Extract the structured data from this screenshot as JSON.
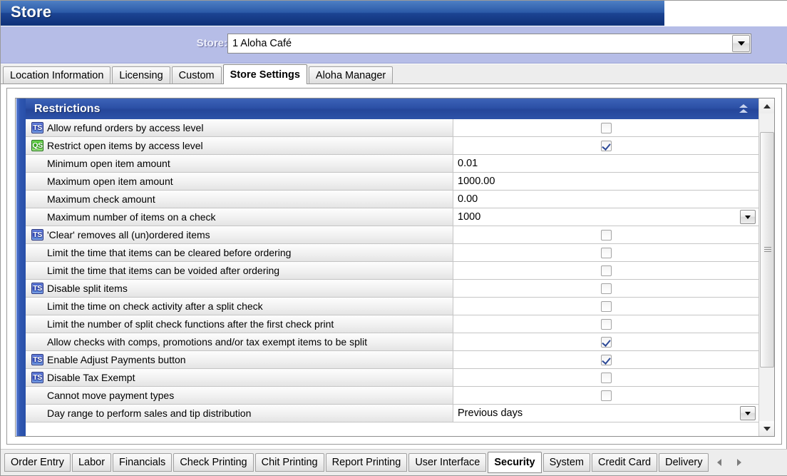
{
  "window": {
    "title": "Store"
  },
  "store_selector": {
    "label": "Store:",
    "value": "1 Aloha Café",
    "dropdown_icon": "chevron-down-icon"
  },
  "top_tabs": [
    {
      "label": "Location Information",
      "active": false
    },
    {
      "label": "Licensing",
      "active": false
    },
    {
      "label": "Custom",
      "active": false
    },
    {
      "label": "Store Settings",
      "active": true
    },
    {
      "label": "Aloha Manager",
      "active": false
    }
  ],
  "section": {
    "title": "Restrictions",
    "collapse_icon": "double-chevron-up-icon"
  },
  "rows": [
    {
      "badge": "TS",
      "label": "Allow refund orders by access level",
      "type": "checkbox",
      "value": "unchecked"
    },
    {
      "badge": "QS",
      "label": "Restrict open items by access level",
      "type": "checkbox",
      "value": "checked"
    },
    {
      "badge": "",
      "label": "Minimum open item amount",
      "type": "text",
      "value": "0.01"
    },
    {
      "badge": "",
      "label": "Maximum open item amount",
      "type": "text",
      "value": "1000.00"
    },
    {
      "badge": "",
      "label": "Maximum check amount",
      "type": "text",
      "value": "0.00"
    },
    {
      "badge": "",
      "label": "Maximum number of items on a check",
      "type": "dropdown",
      "value": "1000"
    },
    {
      "badge": "TS",
      "label": "'Clear' removes all (un)ordered items",
      "type": "checkbox",
      "value": "unchecked"
    },
    {
      "badge": "",
      "label": "Limit the time that items can be cleared before ordering",
      "type": "checkbox",
      "value": "unchecked"
    },
    {
      "badge": "",
      "label": "Limit the time that items can be voided after ordering",
      "type": "checkbox",
      "value": "unchecked"
    },
    {
      "badge": "TS",
      "label": "Disable split items",
      "type": "checkbox",
      "value": "unchecked"
    },
    {
      "badge": "",
      "label": "Limit the time on check activity after a split check",
      "type": "checkbox",
      "value": "unchecked"
    },
    {
      "badge": "",
      "label": "Limit the number of split check functions after the first check print",
      "type": "checkbox",
      "value": "unchecked"
    },
    {
      "badge": "",
      "label": "Allow checks with comps, promotions and/or tax exempt items to be split",
      "type": "checkbox",
      "value": "checked",
      "highlighted": true
    },
    {
      "badge": "TS",
      "label": "Enable Adjust Payments button",
      "type": "checkbox",
      "value": "checked"
    },
    {
      "badge": "TS",
      "label": "Disable Tax Exempt",
      "type": "checkbox",
      "value": "unchecked"
    },
    {
      "badge": "",
      "label": "Cannot move payment types",
      "type": "checkbox",
      "value": "unchecked"
    },
    {
      "badge": "",
      "label": "Day range to perform sales and tip distribution",
      "type": "dropdown",
      "value": "Previous days"
    }
  ],
  "scrollbar": {
    "up_icon": "arrow-up-icon",
    "down_icon": "arrow-down-icon"
  },
  "bottom_tabs": [
    {
      "label": "Order Entry",
      "active": false
    },
    {
      "label": "Labor",
      "active": false
    },
    {
      "label": "Financials",
      "active": false
    },
    {
      "label": "Check Printing",
      "active": false
    },
    {
      "label": "Chit Printing",
      "active": false
    },
    {
      "label": "Report Printing",
      "active": false
    },
    {
      "label": "User Interface",
      "active": false
    },
    {
      "label": "Security",
      "active": true
    },
    {
      "label": "System",
      "active": false
    },
    {
      "label": "Credit Card",
      "active": false
    },
    {
      "label": "Delivery",
      "active": false
    }
  ],
  "bottom_scroll": {
    "left_icon": "triangle-left-icon",
    "right_icon": "triangle-right-icon"
  },
  "colors": {
    "title_blue": "#1c4493",
    "band_lavender": "#b6bde7",
    "section_blue": "#2c50a6",
    "annotation_red": "#f20000",
    "ts_badge_blue": "#2f46b4",
    "qs_badge_green": "#2da417",
    "check_mark_blue": "#2d4a97"
  }
}
